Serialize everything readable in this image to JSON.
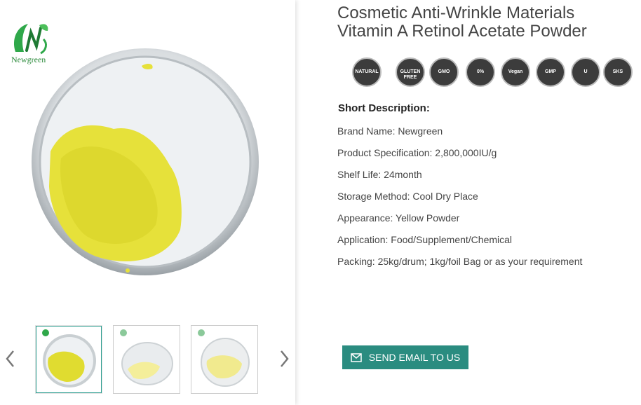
{
  "brand": {
    "logo_text": "Newgreen",
    "accent": "#2a8c80",
    "logo_green": "#2a8a3a"
  },
  "product": {
    "title_line1": "Cosmetic Anti-Wrinkle Materials",
    "title_line2": "Vitamin A Retinol Acetate Powder"
  },
  "badges": [
    {
      "icon": "natural-ingredients-badge-icon",
      "label": "NATURAL"
    },
    {
      "icon": "gluten-free-badge-icon",
      "label": "GLUTEN FREE"
    },
    {
      "icon": "non-gmo-badge-icon",
      "label": "GMO"
    },
    {
      "icon": "no-preservatives-badge-icon",
      "label": "0%"
    },
    {
      "icon": "vegan-friendly-badge-icon",
      "label": "Vegan"
    },
    {
      "icon": "gmp-certified-badge-icon",
      "label": "GMP"
    },
    {
      "icon": "kosher-badge-icon",
      "label": "U"
    },
    {
      "icon": "kosher-sks-badge-icon",
      "label": "SKS"
    }
  ],
  "description": {
    "heading": "Short Description:",
    "lines": [
      "Brand Name: Newgreen",
      "Product Specification: 2,800,000IU/g",
      "Shelf Life: 24month",
      "Storage Method: Cool Dry Place",
      "Appearance: Yellow Powder",
      "Application: Food/Supplement/Chemical",
      "Packing: 25kg/drum; 1kg/foil Bag or as your requirement"
    ]
  },
  "cta": {
    "email_label": "SEND EMAIL TO US"
  },
  "gallery": {
    "thumb_count": 3,
    "active_index": 0
  }
}
